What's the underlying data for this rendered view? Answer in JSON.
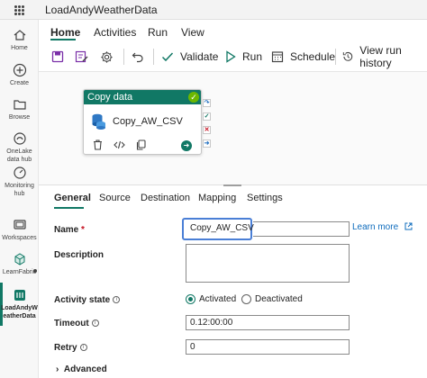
{
  "app": {
    "title": "LoadAndyWeatherData"
  },
  "rail": {
    "items": [
      {
        "label": "Home"
      },
      {
        "label": "Create"
      },
      {
        "label": "Browse"
      },
      {
        "label": "OneLake data hub"
      },
      {
        "label": "Monitoring hub"
      },
      {
        "label": "Workspaces"
      },
      {
        "label": "LearnFabric"
      },
      {
        "label": "LoadAndyW eatherData"
      }
    ]
  },
  "ribbon": {
    "tabs": [
      "Home",
      "Activities",
      "Run",
      "View"
    ],
    "active_tab": "Home",
    "toolbar": {
      "validate": "Validate",
      "run": "Run",
      "schedule": "Schedule",
      "view_run_history": "View run history"
    }
  },
  "canvas": {
    "activity": {
      "type": "Copy data",
      "name": "Copy_AW_CSV",
      "status": "succeeded"
    }
  },
  "properties": {
    "tabs": [
      "General",
      "Source",
      "Destination",
      "Mapping",
      "Settings"
    ],
    "active_tab": "General",
    "fields": {
      "name_label": "Name",
      "name_required_mark": "*",
      "name_value": "Copy_AW_CSV",
      "learn_more": "Learn more",
      "description_label": "Description",
      "activity_state_label": "Activity state",
      "state_options": [
        "Activated",
        "Deactivated"
      ],
      "state_selected": "Activated",
      "timeout_label": "Timeout",
      "timeout_value": "0.12:00:00",
      "retry_label": "Retry",
      "retry_value": "0",
      "advanced": "Advanced"
    }
  },
  "colors": {
    "accent": "#117865",
    "focus": "#4a7fd6",
    "success": "#6bb700",
    "fail": "#c50f1f",
    "link": "#0f6cbd"
  }
}
